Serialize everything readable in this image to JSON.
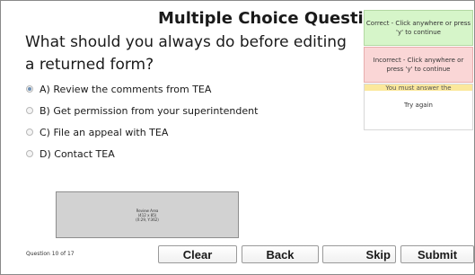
{
  "title": "Multiple Choice Question",
  "question": "What should you always do before editing a returned form?",
  "options": [
    {
      "label": "A) Review the comments from TEA",
      "selected": true
    },
    {
      "label": "B) Get permission from your superintendent",
      "selected": false
    },
    {
      "label": "C) File an appeal with TEA",
      "selected": false
    },
    {
      "label": "D) Contact TEA",
      "selected": false
    }
  ],
  "review_area": {
    "line1": "Review Area",
    "line2": "(412 x 85)",
    "line3": "(X:29, Y:362)"
  },
  "counter": "Question 10 of 17",
  "buttons": {
    "clear": "Clear",
    "back": "Back",
    "skip": "Skip",
    "submit": "Submit"
  },
  "feedback": {
    "correct": "Correct - Click anywhere or press 'y' to continue",
    "incorrect": "Incorrect - Click anywhere or press 'y' to continue",
    "must_answer": "You must answer the",
    "try_again": "Try again"
  },
  "colors": {
    "correct_bg": "#d6f5c9",
    "incorrect_bg": "#fad6d6",
    "warning_strip": "#fbe89c",
    "review_bg": "#d2d2d2"
  }
}
